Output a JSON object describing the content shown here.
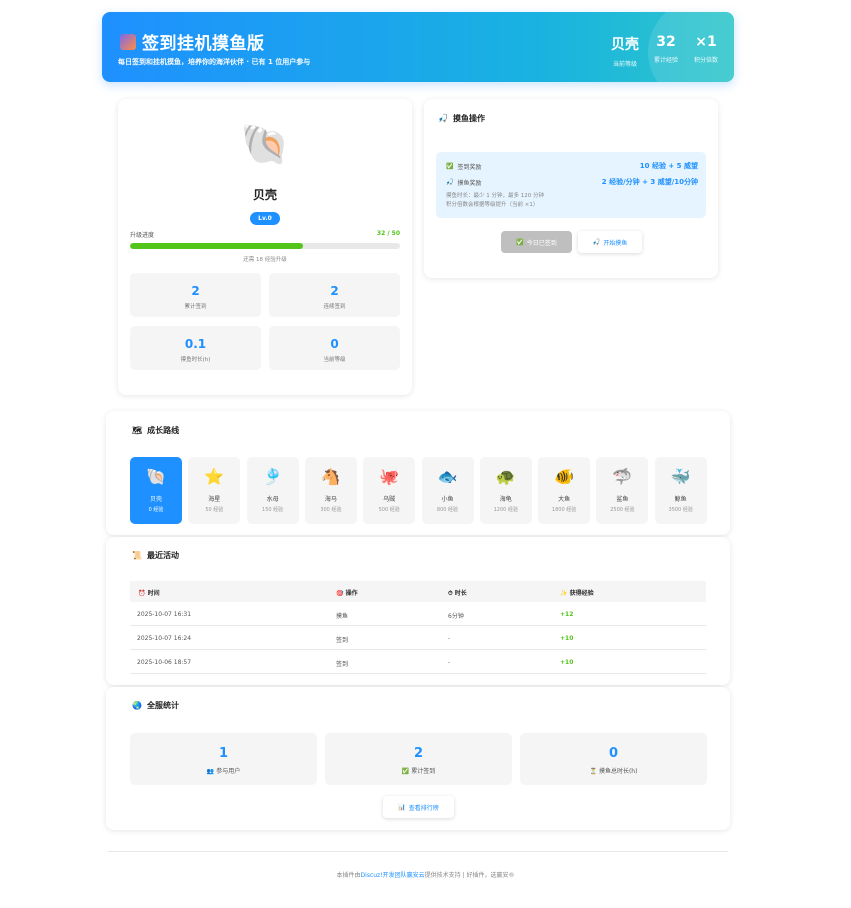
{
  "header": {
    "title": "签到挂机摸鱼版",
    "subtitle": "每日签到和挂机摸鱼，培养你的海洋伙伴 · 已有 1 位用户参与",
    "stats": [
      {
        "value": "贝壳",
        "label": "当前等级"
      },
      {
        "value": "32",
        "label": "累计经验"
      },
      {
        "value": "×1",
        "label": "积分倍数"
      }
    ]
  },
  "profile": {
    "emoji": "🐚",
    "name": "贝壳",
    "level": "Lv.0",
    "progress_label": "升级进度",
    "progress_value": "32 / 50",
    "progress_fraction": 0.64,
    "hint": "还需 18 经验升级",
    "stats": [
      {
        "value": "2",
        "label": "累计签到"
      },
      {
        "value": "2",
        "label": "连续签到"
      },
      {
        "value": "0.1",
        "label": "摸鱼时长(h)"
      },
      {
        "value": "0",
        "label": "当前等级"
      }
    ]
  },
  "fishing": {
    "title": "摸鱼操作",
    "rewards": [
      {
        "icon": "✅",
        "label": "签到奖励",
        "value": "10 经验 + 5 威望"
      },
      {
        "icon": "🎣",
        "label": "摸鱼奖励",
        "value": "2 经验/分钟 + 3 威望/10分钟"
      }
    ],
    "note1": "摸鱼时长：最少 1 分钟，最多 120 分钟",
    "note2": "积分倍数会根据等级提升（当前 ×1）",
    "signed_button": "今日已签到",
    "start_button": "开始摸鱼"
  },
  "growth": {
    "title": "成长路线",
    "items": [
      {
        "emoji": "🐚",
        "name": "贝壳",
        "xp": "0 经验"
      },
      {
        "emoji": "⭐",
        "name": "海星",
        "xp": "50 经验"
      },
      {
        "emoji": "🎐",
        "name": "水母",
        "xp": "150 经验"
      },
      {
        "emoji": "🐴",
        "name": "海马",
        "xp": "300 经验"
      },
      {
        "emoji": "🐙",
        "name": "乌贼",
        "xp": "500 经验"
      },
      {
        "emoji": "🐟",
        "name": "小鱼",
        "xp": "800 经验"
      },
      {
        "emoji": "🐢",
        "name": "海龟",
        "xp": "1200 经验"
      },
      {
        "emoji": "🐠",
        "name": "大鱼",
        "xp": "1800 经验"
      },
      {
        "emoji": "🦈",
        "name": "鲨鱼",
        "xp": "2500 经验"
      },
      {
        "emoji": "🐳",
        "name": "鲸鱼",
        "xp": "3500 经验"
      }
    ]
  },
  "activity": {
    "title": "最近活动",
    "columns": [
      "时间",
      "操作",
      "时长",
      "获得经验"
    ],
    "column_icons": [
      "⏰",
      "🎯",
      "⏱",
      "✨"
    ],
    "rows": [
      {
        "time": "2025-10-07 16:31",
        "action": "摸鱼",
        "duration": "6分钟",
        "gain": "+12"
      },
      {
        "time": "2025-10-07 16:24",
        "action": "签到",
        "duration": "-",
        "gain": "+10"
      },
      {
        "time": "2025-10-06 18:57",
        "action": "签到",
        "duration": "-",
        "gain": "+10"
      }
    ]
  },
  "server": {
    "title": "全服统计",
    "stats": [
      {
        "value": "1",
        "icon": "👥",
        "label": "参与用户"
      },
      {
        "value": "2",
        "icon": "✅",
        "label": "累计签到"
      },
      {
        "value": "0",
        "icon": "⏳",
        "label": "摸鱼总时长(h)"
      }
    ],
    "rank_button": "查看排行榜"
  },
  "footer": {
    "prefix": "本插件由",
    "link1": "Discuz!开发团队",
    "link2": "赢安云",
    "suffix": "提供技术支持 | 好插件，选赢安®"
  },
  "colors": {
    "accent": "#1e90ff",
    "success": "#52c41a"
  }
}
